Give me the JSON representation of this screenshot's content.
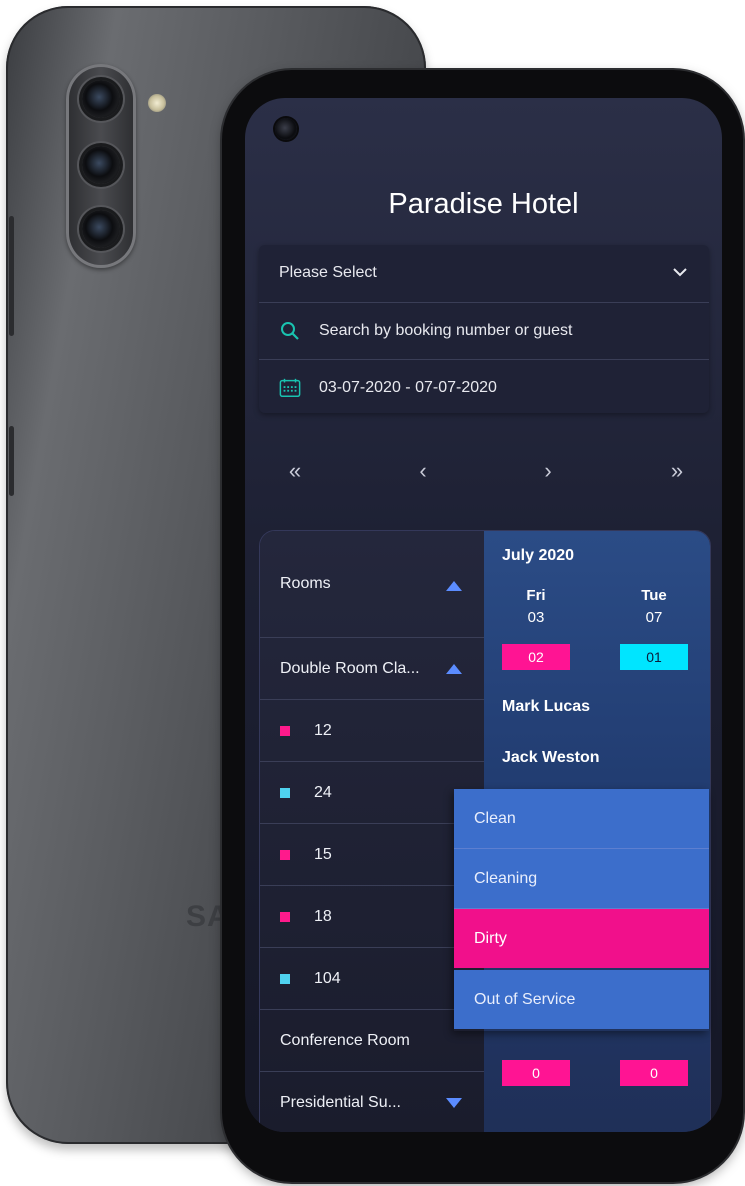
{
  "device": {
    "brand_back": "SA"
  },
  "app": {
    "title": "Paradise Hotel"
  },
  "filters": {
    "select_value": "Please Select",
    "search_placeholder": "Search by booking number or guest",
    "date_range": "03-07-2020 - 07-07-2020"
  },
  "pager": {
    "first": "«",
    "prev": "‹",
    "next": "›",
    "last": "»"
  },
  "rooms": {
    "header": "Rooms",
    "rows": [
      {
        "label": "Double Room Cla...",
        "type": "group",
        "toggle": "up"
      },
      {
        "label": "12",
        "status_color": "#ff1a8c"
      },
      {
        "label": "24",
        "status_color": "#4fd2ef"
      },
      {
        "label": "15",
        "status_color": "#ff1a8c"
      },
      {
        "label": "18",
        "status_color": "#ff1a8c"
      },
      {
        "label": "104",
        "status_color": "#4fd2ef"
      },
      {
        "label": "Conference Room",
        "type": "group"
      },
      {
        "label": "Presidential Su...",
        "type": "group",
        "toggle": "down"
      }
    ]
  },
  "calendar": {
    "month": "July 2020",
    "days": [
      {
        "day": "Fri",
        "date": "03",
        "count_top": "02",
        "count_top_color": "#ff1493",
        "count_bottom": "0",
        "count_bottom_color": "#ff1493"
      },
      {
        "day": "Tue",
        "date": "07",
        "count_top": "01",
        "count_top_color": "#00e5ff",
        "count_bottom": "0",
        "count_bottom_color": "#ff1493"
      }
    ],
    "guests": [
      "Mark Lucas",
      "Jack Weston"
    ]
  },
  "status_menu": {
    "items": [
      {
        "label": "Clean",
        "bg": "#3c6ecb"
      },
      {
        "label": "Cleaning",
        "bg": "#3c6ecb"
      },
      {
        "label": "Dirty",
        "bg": "#f1108b"
      },
      {
        "label": "Out of Service",
        "bg": "#3c6ecb"
      }
    ]
  },
  "colors": {
    "accent_pink": "#ff1493",
    "accent_cyan": "#00e5ff",
    "accent_teal_icon": "#19c3b0",
    "triangle_blue": "#5b8cff"
  }
}
